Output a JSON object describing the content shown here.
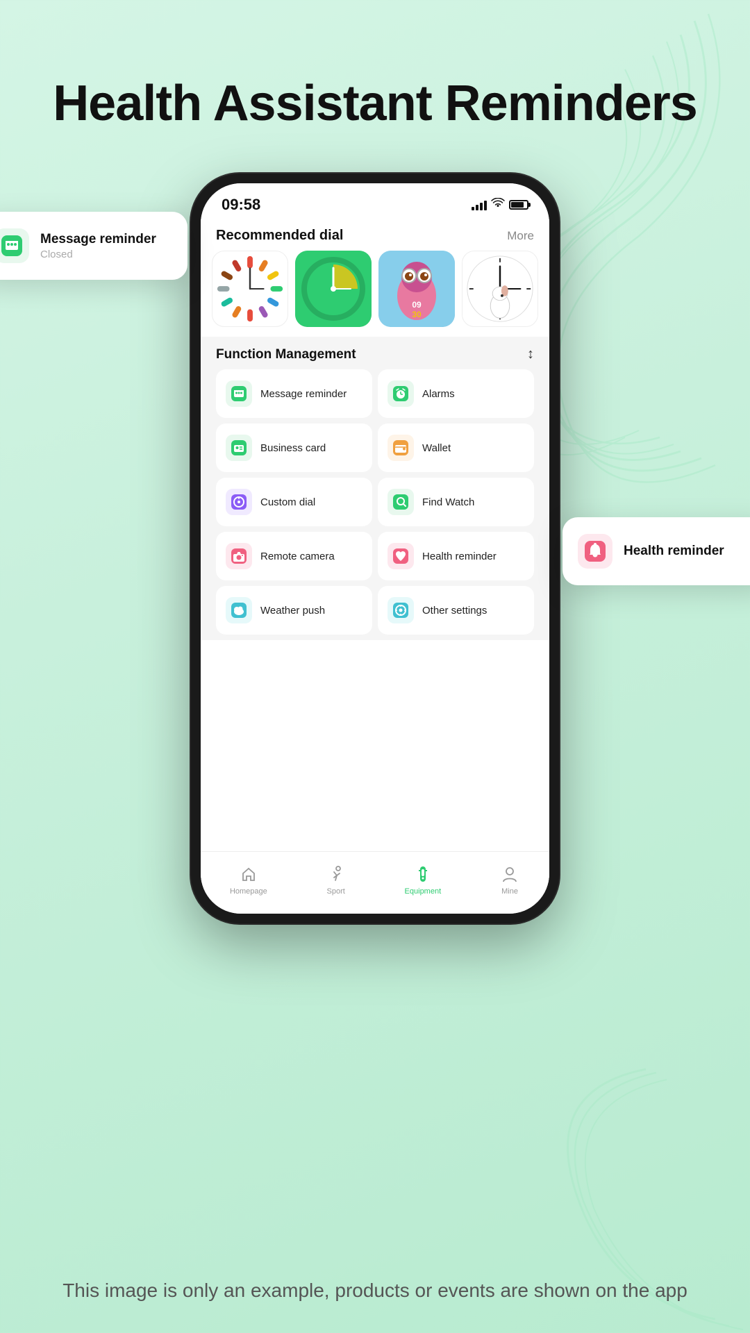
{
  "page": {
    "title": "Health Assistant Reminders",
    "background_color": "#c8f0dc"
  },
  "status_bar": {
    "time": "09:58",
    "signal_strength": 4,
    "wifi": true,
    "battery_percent": 80
  },
  "recommended_dial": {
    "section_title": "Recommended dial",
    "more_label": "More",
    "faces": [
      {
        "id": "colorful",
        "type": "colorful"
      },
      {
        "id": "green",
        "type": "green_circle"
      },
      {
        "id": "alien",
        "type": "alien"
      },
      {
        "id": "snoopy",
        "type": "snoopy"
      }
    ]
  },
  "function_management": {
    "section_title": "Function Management",
    "sort_icon": "sort",
    "items": [
      {
        "id": "message",
        "label": "Message reminder",
        "icon_color": "#2ecc71",
        "icon_emoji": "💬",
        "side": "left"
      },
      {
        "id": "alarms",
        "label": "Alarms",
        "icon_color": "#2ecc71",
        "icon_emoji": "⏰",
        "side": "right"
      },
      {
        "id": "business",
        "label": "Business card",
        "icon_color": "#2ecc71",
        "icon_emoji": "👥",
        "side": "left"
      },
      {
        "id": "wallet",
        "label": "Wallet",
        "icon_color": "#f0a040",
        "icon_emoji": "👛",
        "side": "right"
      },
      {
        "id": "custom",
        "label": "Custom dial",
        "icon_color": "#8b5cf6",
        "icon_emoji": "🎨",
        "side": "left"
      },
      {
        "id": "find",
        "label": "Find Watch",
        "icon_color": "#2ecc71",
        "icon_emoji": "📍",
        "side": "right"
      },
      {
        "id": "camera",
        "label": "Remote camera",
        "icon_color": "#f06080",
        "icon_emoji": "📷",
        "side": "left"
      },
      {
        "id": "health",
        "label": "Health reminder",
        "icon_color": "#f06080",
        "icon_emoji": "🔔",
        "side": "right"
      },
      {
        "id": "weather",
        "label": "Weather push",
        "icon_color": "#40c0d0",
        "icon_emoji": "☁️",
        "side": "left"
      },
      {
        "id": "other",
        "label": "Other settings",
        "icon_color": "#40c0d0",
        "icon_emoji": "⚙️",
        "side": "right"
      }
    ]
  },
  "bottom_nav": {
    "items": [
      {
        "id": "homepage",
        "label": "Homepage",
        "icon": "🏠",
        "active": false
      },
      {
        "id": "sport",
        "label": "Sport",
        "icon": "🏃",
        "active": false
      },
      {
        "id": "equipment",
        "label": "Equipment",
        "icon": "⌚",
        "active": true
      },
      {
        "id": "mine",
        "label": "Mine",
        "icon": "👤",
        "active": false
      }
    ]
  },
  "popups": {
    "message": {
      "title": "Message reminder",
      "subtitle": "Closed",
      "icon_bg": "#e8f8ee",
      "icon": "💬"
    },
    "health": {
      "title": "Health reminder",
      "icon_bg": "#fde8ee",
      "icon": "🔔"
    }
  },
  "disclaimer": {
    "text": "This image is only an example, products or events are shown on the app"
  }
}
